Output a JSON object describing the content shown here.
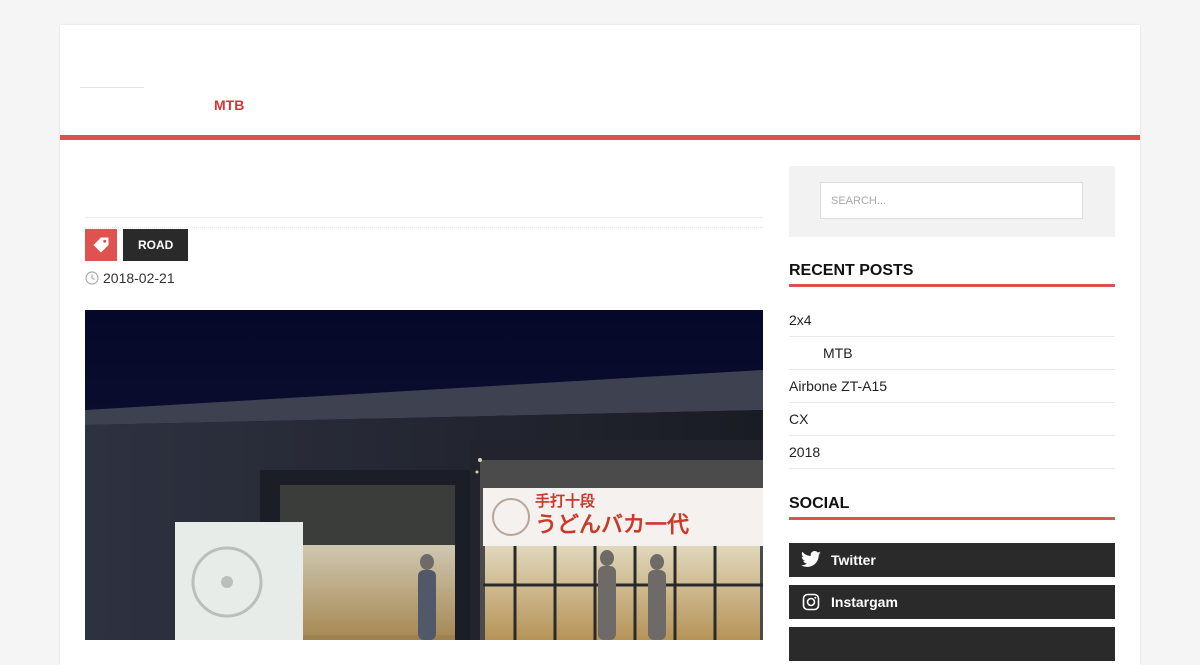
{
  "nav": {
    "items": [
      "MTB"
    ]
  },
  "post": {
    "category": "ROAD",
    "date": "2018-02-21",
    "photo": {
      "sign_line1": "手打十段",
      "sign_line2": "うどんバカ一代"
    }
  },
  "sidebar": {
    "search": {
      "placeholder": "SEARCH..."
    },
    "recent_title": "RECENT POSTS",
    "recent_posts": [
      "2x4",
      "MTB",
      "Airbone ZT-A15",
      "CX",
      "2018"
    ],
    "social_title": "SOCIAL",
    "social": [
      {
        "label": "Twitter",
        "icon": "twitter-icon"
      },
      {
        "label": "Instargam",
        "icon": "instagram-icon"
      }
    ]
  },
  "colors": {
    "accent": "#d9534f",
    "nav_text": "#dd3333",
    "dark_button": "#2a2a2a",
    "tag_box": "#e0524f"
  }
}
